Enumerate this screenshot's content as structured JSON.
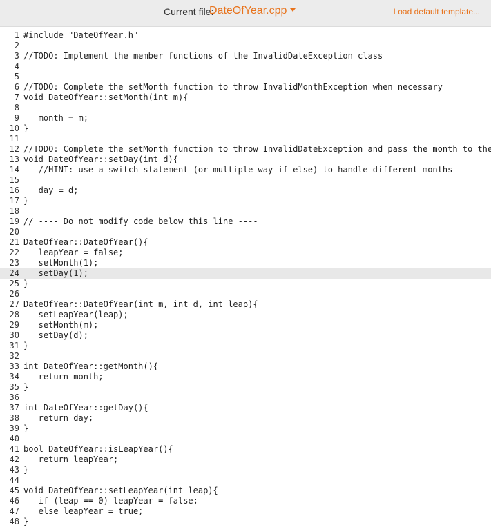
{
  "header": {
    "current_file_label": "Current file:",
    "current_file_name": "DateOfYear.cpp",
    "load_default": "Load default template...",
    "accent_color": "#e8731c",
    "dropdown_icon": "caret-down-icon"
  },
  "editor": {
    "active_line": 24,
    "lines": [
      {
        "n": "1",
        "text": "#include \"DateOfYear.h\"",
        "fold": false
      },
      {
        "n": "2",
        "text": "",
        "fold": false
      },
      {
        "n": "3",
        "text": "//TODO: Implement the member functions of the InvalidDateException class",
        "fold": false
      },
      {
        "n": "4",
        "text": "",
        "fold": false
      },
      {
        "n": "5",
        "text": "",
        "fold": false
      },
      {
        "n": "6",
        "text": "//TODO: Complete the setMonth function to throw InvalidMonthException when necessary",
        "fold": false
      },
      {
        "n": "7",
        "text": "void DateOfYear::setMonth(int m){",
        "fold": false
      },
      {
        "n": "8",
        "text": "",
        "fold": false
      },
      {
        "n": "9",
        "text": "   month = m;",
        "fold": false
      },
      {
        "n": "10",
        "text": "}",
        "fold": true
      },
      {
        "n": "11",
        "text": "",
        "fold": false
      },
      {
        "n": "12",
        "text": "//TODO: Complete the setMonth function to throw InvalidDateException and pass the month to the excepti",
        "fold": false
      },
      {
        "n": "13",
        "text": "void DateOfYear::setDay(int d){",
        "fold": false
      },
      {
        "n": "14",
        "text": "   //HINT: use a switch statement (or multiple way if-else) to handle different months",
        "fold": false
      },
      {
        "n": "15",
        "text": "",
        "fold": false
      },
      {
        "n": "16",
        "text": "   day = d;",
        "fold": false
      },
      {
        "n": "17",
        "text": "}",
        "fold": true
      },
      {
        "n": "18",
        "text": "",
        "fold": false
      },
      {
        "n": "19",
        "text": "// ---- Do not modify code below this line ----",
        "fold": false
      },
      {
        "n": "20",
        "text": "",
        "fold": false
      },
      {
        "n": "21",
        "text": "DateOfYear::DateOfYear(){",
        "fold": false
      },
      {
        "n": "22",
        "text": "   leapYear = false;",
        "fold": false
      },
      {
        "n": "23",
        "text": "   setMonth(1);",
        "fold": false
      },
      {
        "n": "24",
        "text": "   setDay(1);",
        "fold": false
      },
      {
        "n": "25",
        "text": "}",
        "fold": true
      },
      {
        "n": "26",
        "text": "",
        "fold": false
      },
      {
        "n": "27",
        "text": "DateOfYear::DateOfYear(int m, int d, int leap){",
        "fold": false
      },
      {
        "n": "28",
        "text": "   setLeapYear(leap);",
        "fold": false
      },
      {
        "n": "29",
        "text": "   setMonth(m);",
        "fold": false
      },
      {
        "n": "30",
        "text": "   setDay(d);",
        "fold": false
      },
      {
        "n": "31",
        "text": "}",
        "fold": true
      },
      {
        "n": "32",
        "text": "",
        "fold": false
      },
      {
        "n": "33",
        "text": "int DateOfYear::getMonth(){",
        "fold": false
      },
      {
        "n": "34",
        "text": "   return month;",
        "fold": false
      },
      {
        "n": "35",
        "text": "}",
        "fold": true
      },
      {
        "n": "36",
        "text": "",
        "fold": false
      },
      {
        "n": "37",
        "text": "int DateOfYear::getDay(){",
        "fold": false
      },
      {
        "n": "38",
        "text": "   return day;",
        "fold": false
      },
      {
        "n": "39",
        "text": "}",
        "fold": true
      },
      {
        "n": "40",
        "text": "",
        "fold": false
      },
      {
        "n": "41",
        "text": "bool DateOfYear::isLeapYear(){",
        "fold": false
      },
      {
        "n": "42",
        "text": "   return leapYear;",
        "fold": false
      },
      {
        "n": "43",
        "text": "}",
        "fold": true
      },
      {
        "n": "44",
        "text": "",
        "fold": false
      },
      {
        "n": "45",
        "text": "void DateOfYear::setLeapYear(int leap){",
        "fold": false
      },
      {
        "n": "46",
        "text": "   if (leap == 0) leapYear = false;",
        "fold": false
      },
      {
        "n": "47",
        "text": "   else leapYear = true;",
        "fold": false
      },
      {
        "n": "48",
        "text": "}",
        "fold": true
      }
    ]
  }
}
